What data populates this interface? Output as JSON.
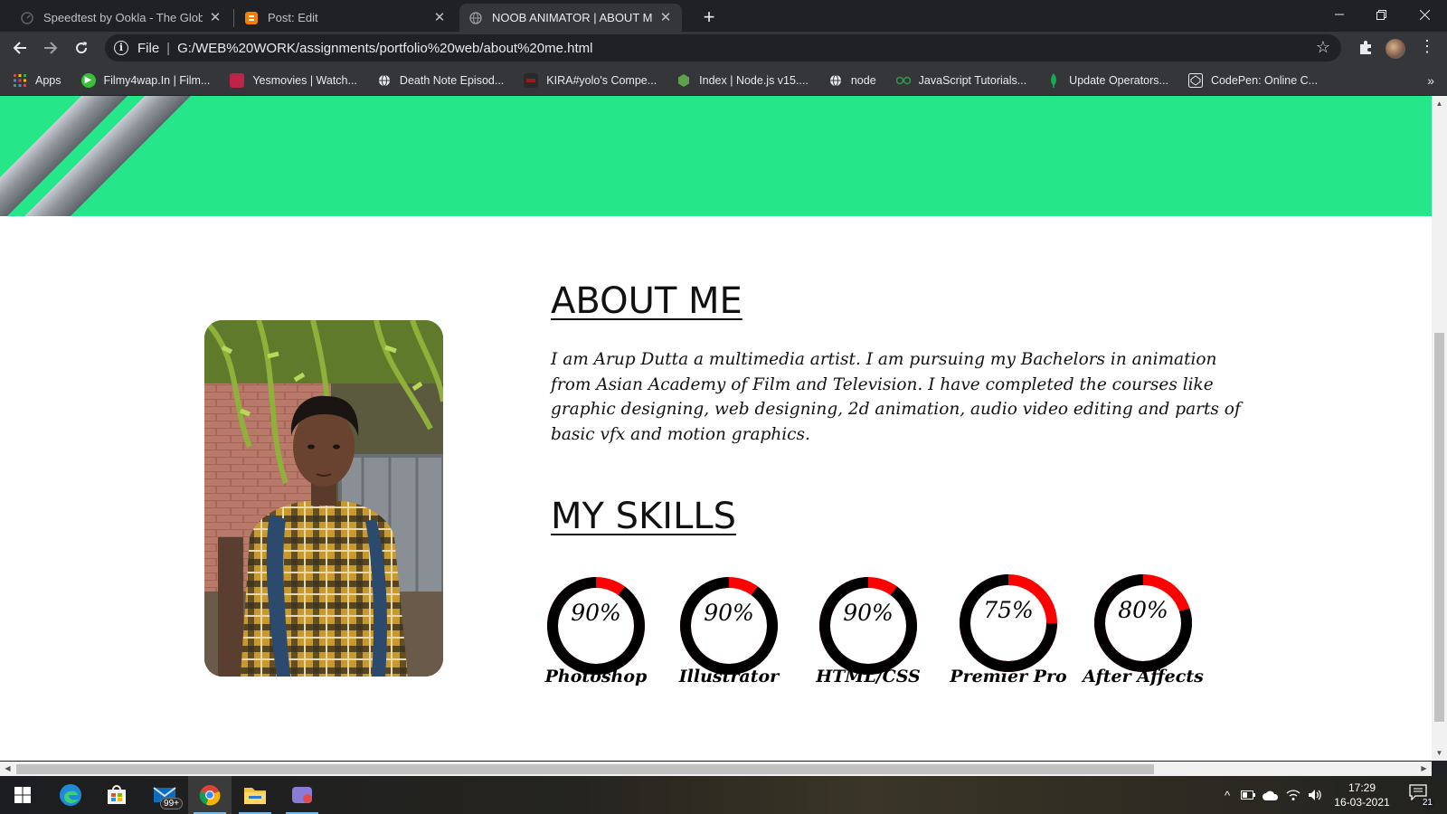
{
  "browser": {
    "tabs": [
      {
        "title": "Speedtest by Ookla - The Global"
      },
      {
        "title": "Post: Edit"
      },
      {
        "title": "NOOB ANIMATOR | ABOUT ME"
      }
    ],
    "omnibox": {
      "scheme": "File",
      "url": "G:/WEB%20WORK/assignments/portfolio%20web/about%20me.html"
    },
    "bookmarks": [
      {
        "label": "Apps",
        "color": "#4285f4"
      },
      {
        "label": "Filmy4wap.In | Film...",
        "color": "#3ac13a"
      },
      {
        "label": "Yesmovies | Watch...",
        "color": "#c0234a"
      },
      {
        "label": "Death Note Episod...",
        "color": "#e8eaed"
      },
      {
        "label": "KIRA#yolo's Compe...",
        "color": "#9a1b1b"
      },
      {
        "label": "Index | Node.js v15....",
        "color": "#5fa04e"
      },
      {
        "label": "node",
        "color": "#e8eaed"
      },
      {
        "label": "JavaScript Tutorials...",
        "color": "#2e9a4a"
      },
      {
        "label": "Update Operators...",
        "color": "#13aa52"
      },
      {
        "label": "CodePen: Online C...",
        "color": "#e8eaed"
      }
    ]
  },
  "page": {
    "about_title": "ABOUT ME",
    "about_text": "I am Arup Dutta a multimedia artist. I am pursuing my Bachelors in animation from Asian Academy of Film and Television. I have completed the courses like graphic designing, web designing, 2d animation, audio video editing and parts of basic vfx and motion graphics.",
    "skills_title": "MY SKILLS",
    "skills": [
      {
        "name": "Photoshop",
        "percent_label": "90%",
        "value": 90
      },
      {
        "name": "Illustrator",
        "percent_label": "90%",
        "value": 90
      },
      {
        "name": "HTML/CSS",
        "percent_label": "90%",
        "value": 90
      },
      {
        "name": "Premier Pro",
        "percent_label": "75%",
        "value": 75
      },
      {
        "name": "After Affects",
        "percent_label": "80%",
        "value": 80
      }
    ],
    "colors": {
      "hero": "#26e68a",
      "ring": "#000000",
      "ring_remaining": "#ff0000"
    }
  },
  "taskbar": {
    "mail_badge": "99+",
    "time": "17:29",
    "date": "16-03-2021",
    "notifications": "21"
  }
}
